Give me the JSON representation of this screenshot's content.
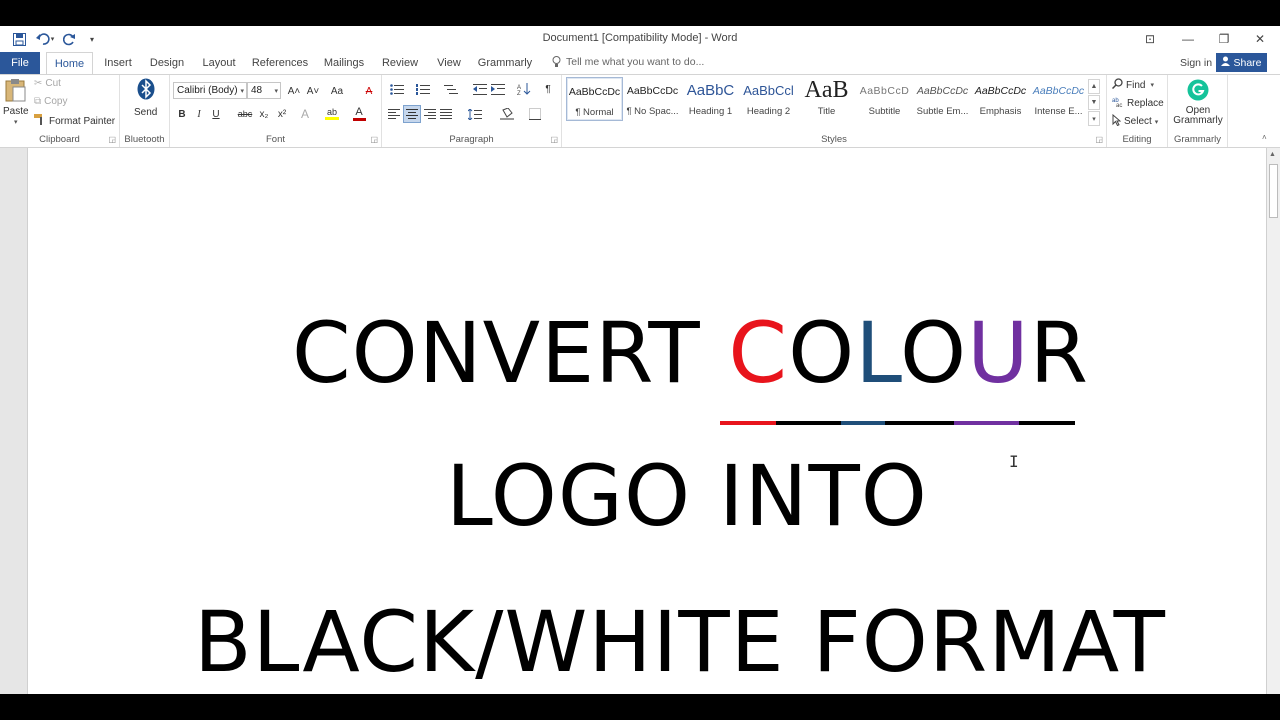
{
  "window": {
    "title": "Document1 [Compatibility Mode] - Word",
    "controls": {
      "ribbon_options": "⊡",
      "minimize": "—",
      "restore": "❐",
      "close": "✕"
    }
  },
  "quick_access": {
    "save_icon": "save-icon",
    "undo_icon": "undo-icon",
    "redo_icon": "redo-icon",
    "customize_icon": "customize-icon"
  },
  "tabs": {
    "file": "File",
    "items": [
      "Home",
      "Insert",
      "Design",
      "Layout",
      "References",
      "Mailings",
      "Review",
      "View",
      "Grammarly"
    ],
    "active": "Home"
  },
  "tell_me": {
    "placeholder": "Tell me what you want to do..."
  },
  "account": {
    "sign_in": "Sign in",
    "share": "Share"
  },
  "ribbon": {
    "clipboard": {
      "label": "Clipboard",
      "paste": "Paste",
      "cut": "Cut",
      "copy": "Copy",
      "format_painter": "Format Painter"
    },
    "bluetooth": {
      "label": "Bluetooth",
      "send": "Send"
    },
    "font": {
      "label": "Font",
      "font_name": "Calibri (Body)",
      "font_size": "48",
      "grow": "A˄",
      "shrink": "A˅",
      "change_case": "Aa",
      "clear": "A",
      "bold": "B",
      "italic": "I",
      "underline": "U",
      "strike": "abc",
      "subscript": "x₂",
      "superscript": "x²",
      "effects": "A",
      "highlight": "ab",
      "font_color": "A",
      "highlight_color": "#ffff00",
      "font_color_value": "#c00000"
    },
    "paragraph": {
      "label": "Paragraph"
    },
    "styles": {
      "label": "Styles",
      "items": [
        {
          "preview": "AaBbCcDc",
          "name": "¶ Normal"
        },
        {
          "preview": "AaBbCcDc",
          "name": "¶ No Spac..."
        },
        {
          "preview": "AaBbC",
          "name": "Heading 1"
        },
        {
          "preview": "AaBbCcl",
          "name": "Heading 2"
        },
        {
          "preview": "AaB",
          "name": "Title"
        },
        {
          "preview": "AaBbCcD",
          "name": "Subtitle"
        },
        {
          "preview": "AaBbCcDc",
          "name": "Subtle Em..."
        },
        {
          "preview": "AaBbCcDc",
          "name": "Emphasis"
        },
        {
          "preview": "AaBbCcDc",
          "name": "Intense E..."
        }
      ]
    },
    "editing": {
      "label": "Editing",
      "find": "Find",
      "replace": "Replace",
      "select": "Select"
    },
    "grammarly": {
      "label": "Grammarly",
      "open": "Open",
      "grammarly": "Grammarly",
      "brand_color": "#15c39a"
    }
  },
  "document": {
    "line1_word1": "CONVERT",
    "line1_letters": [
      "C",
      "O",
      "L",
      "O",
      "U",
      "R"
    ],
    "line1_colors": [
      "#e8141c",
      "#000000",
      "#1f4e79",
      "#000000",
      "#7030a0",
      "#000000"
    ],
    "line2": "LOGO INTO",
    "line3_underlined": "BLACK/WHITE",
    "line3_rest": "FORMAT"
  }
}
